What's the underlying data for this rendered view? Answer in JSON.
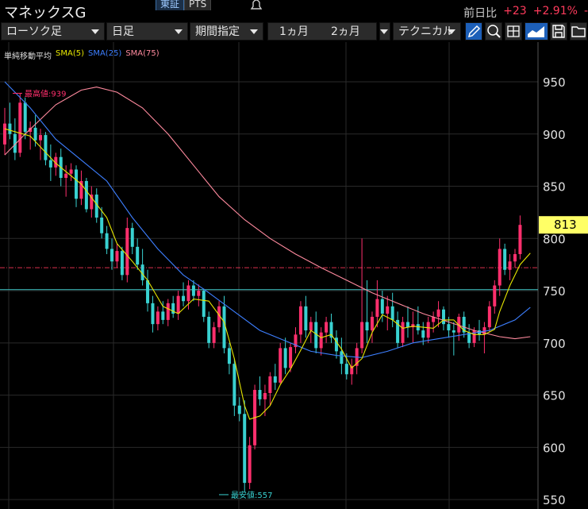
{
  "header": {
    "title": "マネックスG",
    "market_tabs": [
      "東証",
      "PTS"
    ],
    "change_label": "前日比",
    "change_value": "+23",
    "change_percent": "+2.91%",
    "change_trailing": "-"
  },
  "toolbar": {
    "chart_type": "ローソク足",
    "period": "日足",
    "range_mode": "期間指定",
    "range_1m": "1ヵ月",
    "range_2m": "2ヵ月",
    "technical": "テクニカル",
    "icons": [
      "pencil-icon",
      "zoom-123-icon",
      "output-icon",
      "area-chart-icon",
      "save-icon",
      "folder-icon"
    ],
    "active_icon": "pencil-icon"
  },
  "legend": {
    "title": "単純移動平均",
    "sma5": "SMA(5)",
    "sma25": "SMA(25)",
    "sma75": "SMA(75)"
  },
  "colors": {
    "up": "#ff2f6d",
    "down": "#39d1d1",
    "sma5": "#e6e600",
    "sma25": "#3d7fff",
    "sma75": "#ff8a9e",
    "price_badge": "#ffff66",
    "hline_cyan": "#40c8c8",
    "hline_red": "#ff3b5c"
  },
  "chart_data": {
    "type": "candlestick",
    "y_ticks": [
      950,
      900,
      850,
      800,
      750,
      700,
      650,
      600,
      550
    ],
    "ylim": [
      541,
      988
    ],
    "current_price": 813,
    "current_price_label": "813",
    "high_label": "最高値:939",
    "low_label": "最安値:557",
    "high_value": 939,
    "low_value": 557,
    "hline_cyan": 751,
    "hline_red": 772,
    "ohlc": [
      [
        890,
        925,
        880,
        910
      ],
      [
        910,
        930,
        895,
        900
      ],
      [
        900,
        915,
        875,
        882
      ],
      [
        882,
        939,
        878,
        930
      ],
      [
        930,
        935,
        895,
        902
      ],
      [
        902,
        912,
        885,
        906
      ],
      [
        906,
        918,
        888,
        894
      ],
      [
        894,
        905,
        875,
        899
      ],
      [
        899,
        902,
        870,
        875
      ],
      [
        875,
        890,
        855,
        868
      ],
      [
        868,
        882,
        860,
        878
      ],
      [
        878,
        886,
        850,
        858
      ],
      [
        858,
        870,
        840,
        862
      ],
      [
        862,
        872,
        855,
        866
      ],
      [
        866,
        870,
        830,
        838
      ],
      [
        838,
        865,
        832,
        855
      ],
      [
        855,
        858,
        825,
        828
      ],
      [
        828,
        850,
        820,
        842
      ],
      [
        842,
        848,
        815,
        820
      ],
      [
        820,
        830,
        800,
        805
      ],
      [
        805,
        812,
        785,
        790
      ],
      [
        790,
        800,
        770,
        778
      ],
      [
        778,
        795,
        772,
        788
      ],
      [
        788,
        792,
        760,
        765
      ],
      [
        765,
        820,
        758,
        810
      ],
      [
        810,
        815,
        785,
        792
      ],
      [
        792,
        800,
        770,
        775
      ],
      [
        775,
        790,
        755,
        760
      ],
      [
        760,
        770,
        730,
        738
      ],
      [
        738,
        745,
        710,
        718
      ],
      [
        718,
        735,
        712,
        730
      ],
      [
        730,
        740,
        718,
        722
      ],
      [
        722,
        742,
        716,
        738
      ],
      [
        738,
        745,
        724,
        728
      ],
      [
        728,
        750,
        722,
        745
      ],
      [
        745,
        758,
        735,
        740
      ],
      [
        740,
        760,
        732,
        755
      ],
      [
        755,
        760,
        740,
        745
      ],
      [
        745,
        756,
        735,
        750
      ],
      [
        750,
        752,
        720,
        725
      ],
      [
        725,
        730,
        695,
        700
      ],
      [
        700,
        720,
        695,
        715
      ],
      [
        715,
        740,
        710,
        735
      ],
      [
        735,
        745,
        690,
        695
      ],
      [
        695,
        700,
        670,
        680
      ],
      [
        680,
        685,
        630,
        640
      ],
      [
        640,
        648,
        625,
        632
      ],
      [
        632,
        645,
        557,
        566
      ],
      [
        566,
        610,
        560,
        602
      ],
      [
        602,
        660,
        598,
        655
      ],
      [
        655,
        668,
        640,
        646
      ],
      [
        646,
        660,
        630,
        652
      ],
      [
        652,
        672,
        640,
        668
      ],
      [
        668,
        680,
        655,
        662
      ],
      [
        662,
        700,
        660,
        695
      ],
      [
        695,
        705,
        670,
        676
      ],
      [
        676,
        700,
        672,
        696
      ],
      [
        696,
        715,
        690,
        708
      ],
      [
        708,
        740,
        700,
        735
      ],
      [
        735,
        745,
        705,
        712
      ],
      [
        712,
        725,
        700,
        720
      ],
      [
        720,
        730,
        690,
        695
      ],
      [
        695,
        715,
        688,
        710
      ],
      [
        710,
        725,
        700,
        720
      ],
      [
        720,
        728,
        700,
        705
      ],
      [
        705,
        712,
        685,
        692
      ],
      [
        692,
        705,
        670,
        680
      ],
      [
        680,
        690,
        665,
        670
      ],
      [
        670,
        685,
        660,
        678
      ],
      [
        678,
        700,
        670,
        695
      ],
      [
        695,
        800,
        690,
        720
      ],
      [
        720,
        760,
        700,
        712
      ],
      [
        712,
        730,
        700,
        725
      ],
      [
        725,
        760,
        715,
        742
      ],
      [
        742,
        750,
        720,
        728
      ],
      [
        728,
        745,
        712,
        735
      ],
      [
        735,
        748,
        715,
        722
      ],
      [
        722,
        730,
        695,
        700
      ],
      [
        700,
        725,
        696,
        720
      ],
      [
        720,
        735,
        705,
        715
      ],
      [
        715,
        730,
        700,
        718
      ],
      [
        718,
        735,
        708,
        712
      ],
      [
        712,
        720,
        698,
        705
      ],
      [
        705,
        725,
        700,
        720
      ],
      [
        720,
        730,
        710,
        725
      ],
      [
        725,
        740,
        715,
        732
      ],
      [
        732,
        735,
        712,
        718
      ],
      [
        718,
        725,
        705,
        712
      ],
      [
        712,
        720,
        688,
        710
      ],
      [
        710,
        728,
        702,
        725
      ],
      [
        725,
        730,
        705,
        710
      ],
      [
        710,
        718,
        695,
        700
      ],
      [
        700,
        715,
        696,
        712
      ],
      [
        712,
        722,
        702,
        708
      ],
      [
        708,
        720,
        690,
        715
      ],
      [
        715,
        740,
        710,
        735
      ],
      [
        735,
        760,
        728,
        755
      ],
      [
        755,
        800,
        745,
        790
      ],
      [
        790,
        795,
        765,
        770
      ],
      [
        770,
        785,
        760,
        778
      ],
      [
        778,
        790,
        772,
        785
      ],
      [
        785,
        822,
        780,
        813
      ]
    ],
    "sma5": [
      [
        0,
        905
      ],
      [
        5,
        898
      ],
      [
        10,
        872
      ],
      [
        15,
        852
      ],
      [
        20,
        820
      ],
      [
        22,
        795
      ],
      [
        25,
        778
      ],
      [
        28,
        760
      ],
      [
        31,
        735
      ],
      [
        34,
        728
      ],
      [
        37,
        742
      ],
      [
        40,
        740
      ],
      [
        43,
        720
      ],
      [
        45,
        685
      ],
      [
        47,
        640
      ],
      [
        48,
        627
      ],
      [
        50,
        630
      ],
      [
        52,
        640
      ],
      [
        54,
        660
      ],
      [
        56,
        675
      ],
      [
        58,
        693
      ],
      [
        60,
        712
      ],
      [
        62,
        705
      ],
      [
        64,
        708
      ],
      [
        66,
        694
      ],
      [
        68,
        676
      ],
      [
        70,
        685
      ],
      [
        72,
        710
      ],
      [
        74,
        727
      ],
      [
        76,
        722
      ],
      [
        78,
        714
      ],
      [
        80,
        716
      ],
      [
        82,
        715
      ],
      [
        84,
        714
      ],
      [
        86,
        722
      ],
      [
        88,
        722
      ],
      [
        90,
        712
      ],
      [
        92,
        708
      ],
      [
        94,
        708
      ],
      [
        96,
        713
      ],
      [
        97,
        730
      ],
      [
        99,
        755
      ],
      [
        101,
        775
      ],
      [
        103,
        786
      ]
    ],
    "sma25": [
      [
        0,
        950
      ],
      [
        5,
        925
      ],
      [
        10,
        895
      ],
      [
        15,
        875
      ],
      [
        20,
        855
      ],
      [
        25,
        820
      ],
      [
        30,
        790
      ],
      [
        35,
        765
      ],
      [
        40,
        748
      ],
      [
        45,
        730
      ],
      [
        50,
        712
      ],
      [
        55,
        702
      ],
      [
        60,
        692
      ],
      [
        65,
        688
      ],
      [
        70,
        686
      ],
      [
        75,
        692
      ],
      [
        80,
        700
      ],
      [
        85,
        704
      ],
      [
        90,
        708
      ],
      [
        95,
        712
      ],
      [
        100,
        722
      ],
      [
        103,
        734
      ]
    ],
    "sma75": [
      [
        0,
        880
      ],
      [
        4,
        900
      ],
      [
        10,
        928
      ],
      [
        15,
        942
      ],
      [
        18,
        945
      ],
      [
        22,
        940
      ],
      [
        27,
        925
      ],
      [
        32,
        900
      ],
      [
        37,
        870
      ],
      [
        42,
        840
      ],
      [
        47,
        818
      ],
      [
        52,
        800
      ],
      [
        57,
        785
      ],
      [
        62,
        772
      ],
      [
        67,
        760
      ],
      [
        72,
        748
      ],
      [
        77,
        738
      ],
      [
        82,
        728
      ],
      [
        87,
        720
      ],
      [
        92,
        712
      ],
      [
        97,
        706
      ],
      [
        100,
        704
      ],
      [
        103,
        706
      ]
    ]
  }
}
